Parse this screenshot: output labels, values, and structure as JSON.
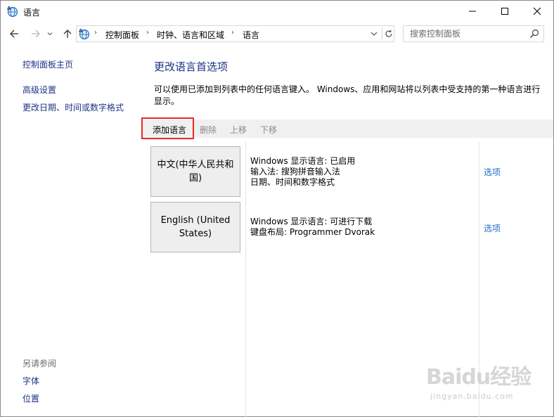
{
  "window": {
    "title": "语言",
    "minimize_icon": "minimize-icon",
    "maximize_icon": "maximize-icon",
    "close_icon": "close-icon"
  },
  "address_bar": {
    "breadcrumbs": [
      "控制面板",
      "时钟、语言和区域",
      "语言"
    ],
    "search_placeholder": "搜索控制面板"
  },
  "left_pane": {
    "home_link": "控制面板主页",
    "links": [
      "高级设置",
      "更改日期、时间或数字格式"
    ],
    "see_also_title": "另请参阅",
    "see_also_links": [
      "字体",
      "位置"
    ]
  },
  "main": {
    "title": "更改语言首选项",
    "description": "可以使用已添加到列表中的任何语言键入。 Windows、应用和网站将以列表中受支持的第一种语言进行显示。",
    "toolbar": {
      "add_label": "添加语言",
      "remove_label": "删除",
      "up_label": "上移",
      "down_label": "下移"
    },
    "languages": [
      {
        "name": "中文(中华人民共和国)",
        "details": [
          "Windows 显示语言: 已启用",
          "输入法: 搜狗拼音输入法",
          "日期、时间和数字格式"
        ],
        "options_label": "选项"
      },
      {
        "name": "English (United States)",
        "details": [
          "Windows 显示语言: 可进行下载",
          "键盘布局: Programmer Dvorak"
        ],
        "options_label": "选项"
      }
    ]
  },
  "watermark": {
    "logo": "Baidu经验",
    "sub": "jingyan.baidu.com"
  },
  "colors": {
    "link": "#1e3287",
    "option_link": "#1e6ec8",
    "highlight": "#e62a2a",
    "toolbar_bg": "#f0f0f0"
  }
}
